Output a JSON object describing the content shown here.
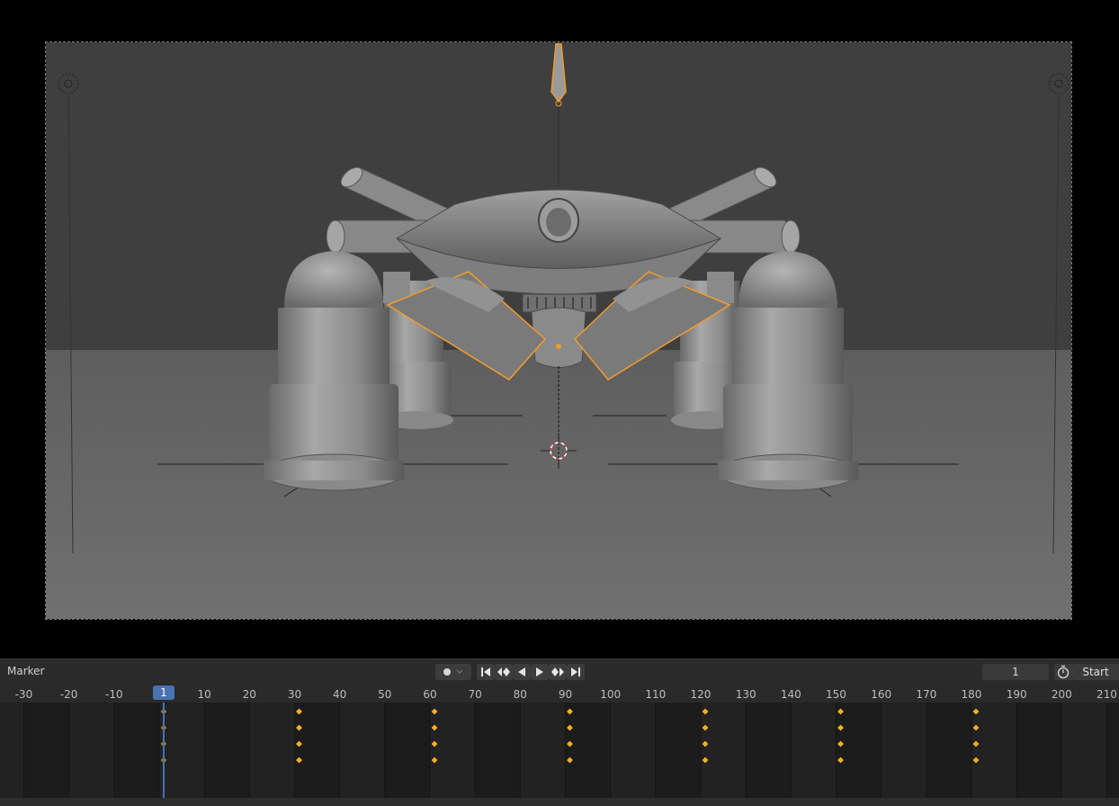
{
  "viewport": {
    "colors": {
      "background": "#000000",
      "wall": "#3f3f3f",
      "floor": "#6a6a6a",
      "selection": "#f29b2b",
      "model": "#8e8e8e"
    }
  },
  "timeline": {
    "marker_label": "Marker",
    "current_frame": "1",
    "frame_field_value": "1",
    "start_label": "Start",
    "ruler_labels": [
      "-30",
      "-20",
      "-10",
      "10",
      "20",
      "30",
      "40",
      "50",
      "60",
      "70",
      "80",
      "90",
      "100",
      "110",
      "120",
      "130",
      "140",
      "150",
      "160",
      "170",
      "180",
      "190",
      "200",
      "210"
    ],
    "keyframe_frames": [
      1,
      31,
      61,
      91,
      121,
      151,
      181
    ],
    "keyframe_rows": 4,
    "colors": {
      "keyframe": "#f0b02a",
      "playhead": "#4772b3",
      "accent": "#4772b3"
    },
    "icons": [
      "record-dot-icon",
      "dropdown-chevron-icon",
      "jump-start-icon",
      "prev-keyframe-icon",
      "play-reverse-icon",
      "play-icon",
      "next-keyframe-icon",
      "jump-end-icon",
      "stopwatch-icon"
    ]
  }
}
